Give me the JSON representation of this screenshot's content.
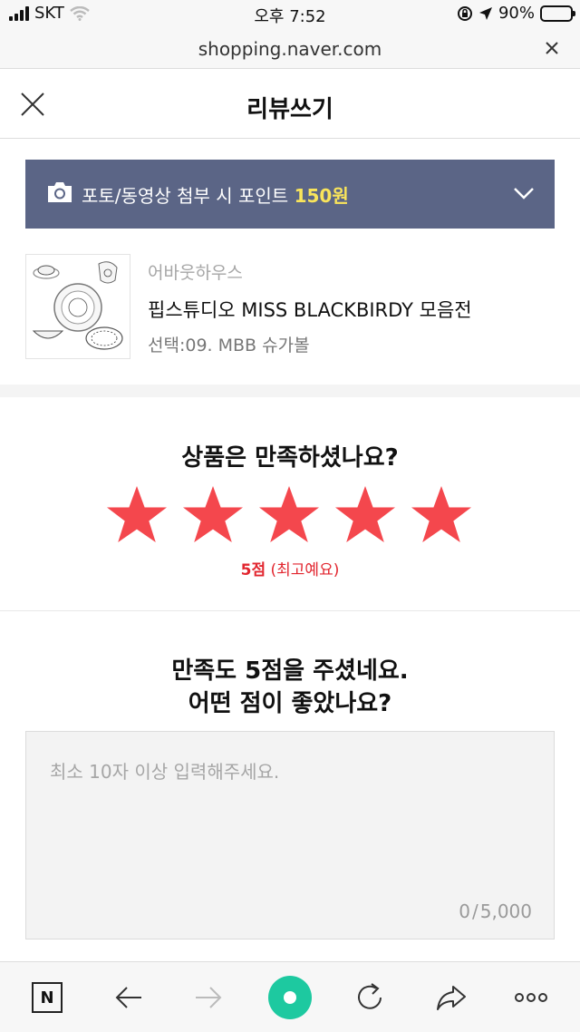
{
  "status": {
    "carrier": "SKT",
    "time": "오후 7:52",
    "battery": "90%",
    "battery_level": 0.9
  },
  "browser": {
    "url": "shopping.naver.com"
  },
  "header": {
    "title": "리뷰쓰기"
  },
  "banner": {
    "text": "포토/동영상 첨부 시 포인트",
    "points": "150원"
  },
  "product": {
    "brand": "어바웃하우스",
    "name": "핍스튜디오 MISS BLACKBIRDY 모음전",
    "option": "선택:09. MBB 슈가볼"
  },
  "rating": {
    "question": "상품은 만족하셨나요?",
    "stars": 5,
    "max_stars": 5,
    "score": "5점",
    "score_desc": "(최고예요)"
  },
  "review": {
    "question_line1": "만족도 5점을 주셨네요.",
    "question_line2": "어떤 점이 좋았나요?",
    "placeholder": "최소 10자 이상 입력해주세요.",
    "count": "0",
    "max": "5,000"
  },
  "toolbar": {
    "home_label": "N"
  },
  "colors": {
    "banner": "#5b6586",
    "points": "#f9e45b",
    "star": "#f4474d",
    "score": "#e2262f",
    "green": "#1dc9a0"
  }
}
